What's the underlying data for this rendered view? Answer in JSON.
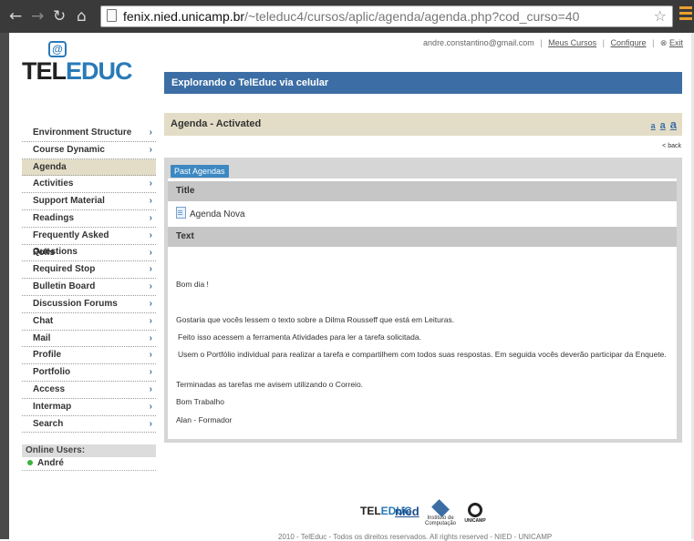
{
  "browser": {
    "url_host": "fenix.nied.unicamp.br",
    "url_path": "/~teleduc4/cursos/aplic/agenda/agenda.php?cod_curso=40"
  },
  "header": {
    "email": "andre.constantino@gmail.com",
    "links": [
      "Meus Cursos",
      "Configure",
      "Exit"
    ],
    "logo_text": "TELEDUC",
    "course_title": "Explorando o TelEduc via celular"
  },
  "sidebar": {
    "items": [
      {
        "label": "Environment Structure"
      },
      {
        "label": "Course Dynamic"
      },
      {
        "label": "Agenda"
      },
      {
        "label": "Activities"
      },
      {
        "label": "Support Material"
      },
      {
        "label": "Readings"
      },
      {
        "label": "Frequently Asked Questions"
      },
      {
        "label": "Polls"
      },
      {
        "label": "Required Stop"
      },
      {
        "label": "Bulletin Board"
      },
      {
        "label": "Discussion Forums"
      },
      {
        "label": "Chat"
      },
      {
        "label": "Mail"
      },
      {
        "label": "Profile"
      },
      {
        "label": "Portfolio"
      },
      {
        "label": "Access"
      },
      {
        "label": "Intermap"
      },
      {
        "label": "Search"
      }
    ],
    "online_header": "Online Users:",
    "online_user": "André"
  },
  "main": {
    "section_title": "Agenda - Activated",
    "font_sizes": [
      "a",
      "a",
      "a"
    ],
    "back_link": "< back",
    "past_agendas": "Past Agendas",
    "title_header": "Title",
    "agenda_name": "Agenda Nova",
    "text_header": "Text",
    "paragraphs": [
      "Bom dia !",
      "Gostaria que vocês lessem o texto sobre a Dilma Rousseff que está em Leituras.",
      "Feito isso acessem a ferramenta Atividades para ler a tarefa solicitada.",
      "Usem o Portfólio individual para realizar a tarefa e compartilhem com todos suas respostas. Em seguida vocês deverão participar da Enquete.",
      "Terminadas as tarefas me avisem utilizando o Correio.",
      "Bom Trabalho",
      "Alan -  Formador"
    ]
  },
  "footer": {
    "logo_teleduc": "TELEDUC",
    "logo_nied": "nied",
    "logo_ic": "Instituto de Computação",
    "logo_unicamp": "UNICAMP",
    "copyright": "2010 - TelEduc - Todos os direitos reservados. All rights reserved - NIED - UNICAMP"
  }
}
